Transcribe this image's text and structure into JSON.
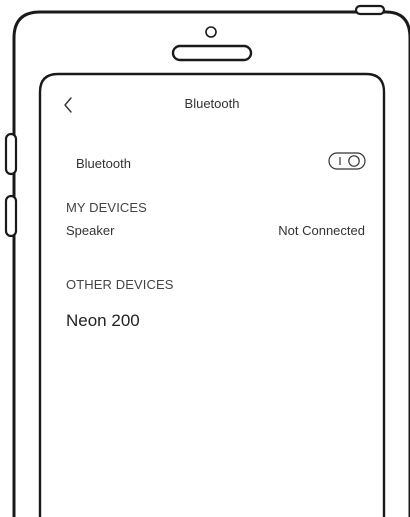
{
  "header": {
    "title": "Bluetooth",
    "back_icon": "chevron-left-icon"
  },
  "bluetooth_toggle": {
    "label": "Bluetooth",
    "icon": "toggle-icon"
  },
  "my_devices": {
    "heading": "MY DEVICES",
    "items": [
      {
        "name": "Speaker",
        "status": "Not Connected"
      }
    ]
  },
  "other_devices": {
    "heading": "OTHER DEVICES",
    "items": [
      {
        "name": "Neon 200"
      }
    ]
  },
  "colors": {
    "outline": "#1a1a1a",
    "text": "#333333",
    "background": "#ffffff"
  }
}
